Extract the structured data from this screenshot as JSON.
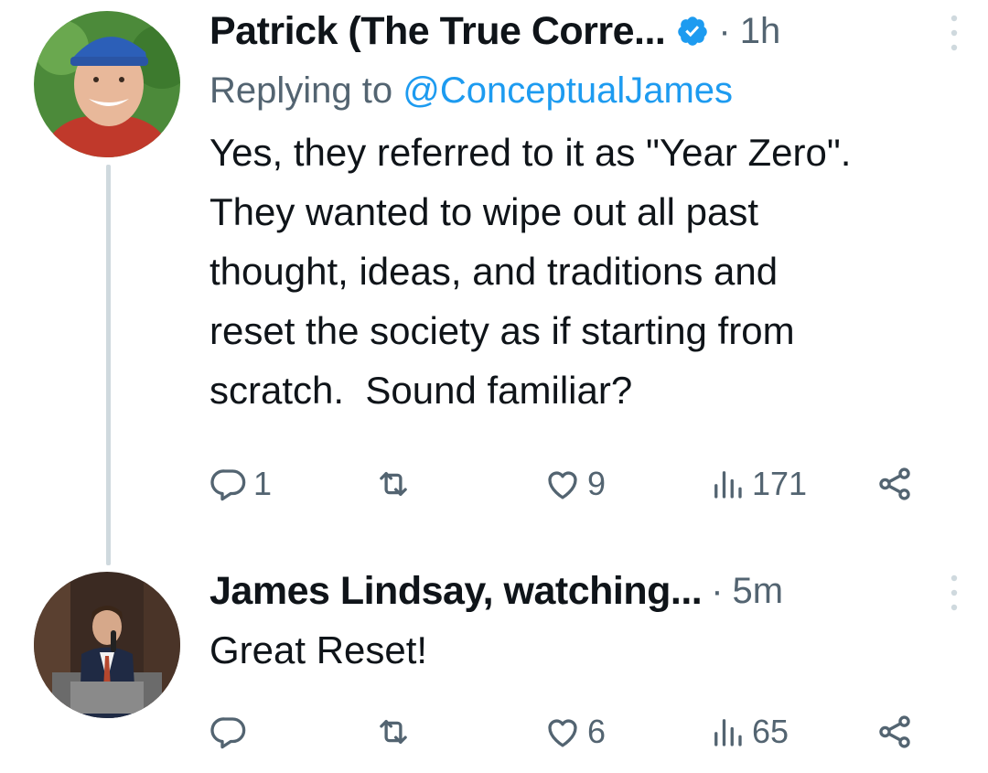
{
  "tweets": [
    {
      "author": "Patrick (The True Corre...",
      "verified": true,
      "separator": "·",
      "time": "1h",
      "replying_prefix": "Replying to",
      "replying_handle": "@ConceptualJames",
      "text": "Yes, they referred to it as \"Year Zero\".\nThey wanted to wipe out all past\nthought, ideas, and traditions and\nreset the society as if starting from\nscratch.  Sound familiar?",
      "replies": "1",
      "retweets": "",
      "likes": "9",
      "views": "171"
    },
    {
      "author": "James Lindsay, watching...",
      "separator": "·",
      "time": "5m",
      "text": "Great Reset!",
      "replies": "",
      "retweets": "",
      "likes": "6",
      "views": "65"
    }
  ],
  "colors": {
    "text": "#0f1419",
    "muted": "#536471",
    "link": "#1d9bf0",
    "thread_line": "#cfd9de",
    "verified": "#1d9bf0"
  },
  "icons": [
    "reply-icon",
    "retweet-icon",
    "like-icon",
    "views-icon",
    "share-icon",
    "more-icon",
    "verified-badge-icon"
  ]
}
